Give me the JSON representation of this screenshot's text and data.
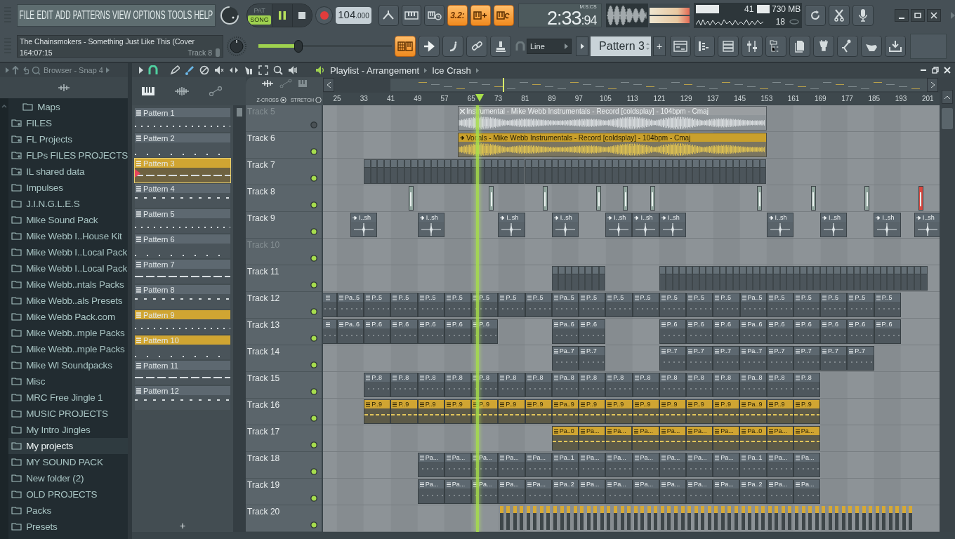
{
  "toolbar": {
    "menu": [
      "FILE",
      "EDIT",
      "ADD",
      "PATTERNS",
      "VIEW",
      "OPTIONS",
      "TOOLS",
      "HELP"
    ],
    "hint": {
      "title": "The Chainsmokers - Something Just Like This (Cover",
      "position": "164:07:15",
      "target": "Track 8"
    },
    "mode": [
      {
        "label": "PAT",
        "selected": false
      },
      {
        "label": "SONG",
        "selected": true
      }
    ],
    "playing": true,
    "tempo": {
      "whole": "104",
      "fraction": ".000"
    },
    "toggles": [
      {
        "kind": "typing",
        "on": false
      },
      {
        "kind": "metronome",
        "on": false
      },
      {
        "kind": "countdown",
        "label": "3.2:",
        "on": true
      },
      {
        "kind": "step",
        "on": true
      },
      {
        "kind": "loop",
        "on": true
      }
    ],
    "time": {
      "main": "2:33",
      "fraction": ":94",
      "unit": "M:S:CS"
    },
    "cpu": {
      "value": "41",
      "level": 0.5
    },
    "memory": "730 MB",
    "polyphony": "18",
    "master_volume": {
      "level": 0.3
    },
    "view_toggles": [
      {
        "kind": "keyboard",
        "on": true
      },
      {
        "kind": "arrow",
        "on": false
      },
      {
        "kind": "foot",
        "on": false
      },
      {
        "kind": "link",
        "on": false
      },
      {
        "kind": "stamp",
        "on": false
      }
    ],
    "snap": "Line",
    "pattern": "Pattern 3",
    "add": "+"
  },
  "browser": {
    "title": "Browser - Snap 4",
    "items": [
      {
        "children": [
          {
            "label": "Maps",
            "kind": "folder",
            "selected": false
          }
        ]
      },
      {
        "label": "FILES",
        "kind": "linked",
        "selected": false
      },
      {
        "label": "FL Projects",
        "kind": "linked",
        "selected": false
      },
      {
        "label": "FLPs FILES PROJECTS",
        "kind": "linked",
        "selected": false
      },
      {
        "label": "IL shared data",
        "kind": "linked",
        "selected": false
      },
      {
        "label": "Impulses",
        "kind": "folder",
        "selected": false
      },
      {
        "label": "J.I.N.G.L.E.S",
        "kind": "folder",
        "selected": false
      },
      {
        "label": "Mike Sound Pack",
        "kind": "folder",
        "selected": false
      },
      {
        "label": "Mike Webb I..House Kit",
        "kind": "folder",
        "selected": false
      },
      {
        "label": "Mike Webb I..Local Pack",
        "kind": "folder",
        "selected": false
      },
      {
        "label": "Mike Webb I..Local Pack",
        "kind": "folder",
        "selected": false
      },
      {
        "label": "Mike Webb..ntals Packs",
        "kind": "folder",
        "selected": false
      },
      {
        "label": "Mike Webb..als Presets",
        "kind": "folder",
        "selected": false
      },
      {
        "label": "Mike Webb Pack.com",
        "kind": "folder",
        "selected": false
      },
      {
        "label": "Mike Webb..mple Packs",
        "kind": "folder",
        "selected": false
      },
      {
        "label": "Mike Webb..mple Packs",
        "kind": "folder",
        "selected": false
      },
      {
        "label": "Mike Wl Soundpacks",
        "kind": "folder",
        "selected": false
      },
      {
        "label": "Misc",
        "kind": "folder",
        "selected": false
      },
      {
        "label": "MRC Free Jingle 1",
        "kind": "folder",
        "selected": false
      },
      {
        "label": "MUSIC PROJECTS",
        "kind": "folder",
        "selected": false
      },
      {
        "label": "My Intro Jingles",
        "kind": "folder",
        "selected": false
      },
      {
        "label": "My projects",
        "kind": "folder",
        "selected": true
      },
      {
        "label": "MY SOUND PACK",
        "kind": "folder",
        "selected": false
      },
      {
        "label": "New folder (2)",
        "kind": "folder",
        "selected": false
      },
      {
        "label": "OLD PROJECTS",
        "kind": "folder",
        "selected": false
      },
      {
        "label": "Packs",
        "kind": "folder",
        "selected": false
      },
      {
        "label": "Presets",
        "kind": "folder",
        "selected": false
      }
    ]
  },
  "playlist": {
    "title": "Playlist - Arrangement",
    "arrangement": "Ice Crash",
    "zcross": {
      "label": "Z-CROSS",
      "on": true
    },
    "stretch": {
      "label": "STRETCH",
      "on": false
    },
    "patterns": [
      {
        "label": "Pattern 1",
        "color": "#5d6870",
        "selected": false
      },
      {
        "label": "Pattern 2",
        "color": "#5d6870",
        "selected": false
      },
      {
        "label": "Pattern 3",
        "color": "#d0a532",
        "selected": true
      },
      {
        "label": "Pattern 4",
        "color": "#5d6870",
        "selected": false
      },
      {
        "label": "Pattern 5",
        "color": "#5d6870",
        "selected": false
      },
      {
        "label": "Pattern 6",
        "color": "#5d6870",
        "selected": false
      },
      {
        "label": "Pattern 7",
        "color": "#5d6870",
        "selected": false
      },
      {
        "label": "Pattern 8",
        "color": "#5d6870",
        "selected": false
      },
      {
        "label": "Pattern 9",
        "color": "#d0a532",
        "selected": false
      },
      {
        "label": "Pattern 10",
        "color": "#d0a532",
        "selected": false
      },
      {
        "label": "Pattern 11",
        "color": "#5d6870",
        "selected": false
      },
      {
        "label": "Pattern 12",
        "color": "#5d6870",
        "selected": false
      }
    ],
    "add_pattern": "+",
    "ruler": [
      "25",
      "33",
      "41",
      "49",
      "57",
      "65",
      "73",
      "81",
      "89",
      "97",
      "105",
      "113",
      "121",
      "129",
      "137",
      "145",
      "153",
      "161",
      "169",
      "177",
      "185",
      "193",
      "201"
    ],
    "position": {
      "level": 0.2506
    },
    "tracks": [
      {
        "name": "Track 5",
        "dimmed": true,
        "muted": true,
        "clips": [
          {
            "kind": "gap"
          },
          {
            "kind": "gap"
          },
          {
            "kind": "gap"
          },
          {
            "kind": "gap"
          },
          {
            "kind": "gap"
          },
          {
            "kind": "gap"
          },
          {
            "kind": "gap"
          },
          {
            "kind": "gap"
          },
          {
            "kind": "gap"
          },
          {
            "kind": "gap"
          },
          {
            "kind": "gap"
          },
          {
            "kind": "audio",
            "label": "Instrumental - Mike Webb Instrumentals - Record [coldsplay] - 104bpm - Cmaj",
            "muted": true,
            "color": "#9a9ea1"
          }
        ]
      },
      {
        "name": "Track 6",
        "dimmed": false,
        "muted": false,
        "clips": [
          {
            "kind": "gap"
          },
          {
            "kind": "gap"
          },
          {
            "kind": "gap"
          },
          {
            "kind": "gap"
          },
          {
            "kind": "gap"
          },
          {
            "kind": "gap"
          },
          {
            "kind": "gap"
          },
          {
            "kind": "gap"
          },
          {
            "kind": "gap"
          },
          {
            "kind": "gap"
          },
          {
            "kind": "gap"
          },
          {
            "kind": "audio",
            "label": "Vocals - Mike Webb Instrumentals - Record [coldsplay] - 104bpm - Cmaj",
            "muted": false,
            "color": "#c9a02c"
          }
        ]
      },
      {
        "name": "Track 7",
        "dimmed": false,
        "muted": false,
        "clips": [
          {
            "kind": "gap"
          },
          {
            "kind": "gap"
          },
          {
            "kind": "gap"
          },
          {
            "kind": "gap"
          },
          {
            "kind": "mini"
          },
          {
            "kind": "mini"
          },
          {
            "kind": "mini"
          },
          {
            "kind": "mini"
          },
          {
            "kind": "mini"
          },
          {
            "kind": "mini"
          },
          {
            "kind": "mini"
          },
          {
            "kind": "mini"
          },
          {
            "kind": "mini"
          },
          {
            "kind": "mini"
          },
          {
            "kind": "mini"
          },
          {
            "kind": "mini"
          },
          {
            "kind": "mini"
          },
          {
            "kind": "mini"
          },
          {
            "kind": "mini"
          },
          {
            "kind": "mini"
          },
          {
            "kind": "mini"
          },
          {
            "kind": "mini"
          },
          {
            "kind": "mini"
          },
          {
            "kind": "mini"
          },
          {
            "kind": "mini"
          },
          {
            "kind": "mini"
          },
          {
            "kind": "mini"
          },
          {
            "kind": "mini"
          },
          {
            "kind": "mini"
          },
          {
            "kind": "mini"
          },
          {
            "kind": "mini"
          },
          {
            "kind": "mini"
          },
          {
            "kind": "mini"
          },
          {
            "kind": "mini"
          }
        ]
      },
      {
        "name": "Track 8",
        "dimmed": false,
        "muted": false,
        "clips": [
          {
            "kind": "gap"
          },
          {
            "kind": "gap"
          },
          {
            "kind": "gap"
          },
          {
            "kind": "gap"
          },
          {
            "kind": "gap"
          },
          {
            "kind": "gap"
          },
          {
            "kind": "gap"
          },
          {
            "kind": "automation",
            "color": "#8fa39c"
          },
          {
            "kind": "gap"
          },
          {
            "kind": "gap"
          },
          {
            "kind": "gap"
          },
          {
            "kind": "gap"
          },
          {
            "kind": "gap"
          },
          {
            "kind": "automation",
            "color": "#8fa39c"
          },
          {
            "kind": "gap"
          },
          {
            "kind": "gap"
          },
          {
            "kind": "gap"
          },
          {
            "kind": "automation",
            "color": "#8fa39c"
          },
          {
            "kind": "gap"
          },
          {
            "kind": "gap"
          },
          {
            "kind": "gap"
          },
          {
            "kind": "automation",
            "color": "#8fa39c"
          },
          {
            "kind": "gap"
          },
          {
            "kind": "automation",
            "color": "#8fa39c"
          },
          {
            "kind": "gap"
          },
          {
            "kind": "automation",
            "color": "#8fa39c"
          },
          {
            "kind": "gap"
          },
          {
            "kind": "gap"
          },
          {
            "kind": "gap"
          },
          {
            "kind": "gap"
          },
          {
            "kind": "gap"
          },
          {
            "kind": "gap"
          },
          {
            "kind": "gap"
          },
          {
            "kind": "automation",
            "color": "#8fa39c"
          },
          {
            "kind": "gap"
          },
          {
            "kind": "gap"
          },
          {
            "kind": "gap"
          },
          {
            "kind": "automation",
            "color": "#8fa39c"
          },
          {
            "kind": "gap"
          },
          {
            "kind": "gap"
          },
          {
            "kind": "gap"
          },
          {
            "kind": "automation",
            "color": "#8fa39c"
          },
          {
            "kind": "gap"
          },
          {
            "kind": "gap"
          },
          {
            "kind": "gap"
          },
          {
            "kind": "automation",
            "color": "#d8473f"
          }
        ]
      },
      {
        "name": "Track 9",
        "dimmed": false,
        "muted": false,
        "clips": [
          {
            "kind": "gap"
          },
          {
            "kind": "gap"
          },
          {
            "kind": "gap"
          },
          {
            "kind": "one_shot",
            "label": "I..sh"
          },
          {
            "kind": "gap"
          },
          {
            "kind": "gap"
          },
          {
            "kind": "gap"
          },
          {
            "kind": "one_shot",
            "label": "I..sh"
          },
          {
            "kind": "gap"
          },
          {
            "kind": "gap"
          },
          {
            "kind": "gap"
          },
          {
            "kind": "gap"
          },
          {
            "kind": "one_shot",
            "label": "I..sh"
          },
          {
            "kind": "gap"
          },
          {
            "kind": "gap"
          },
          {
            "kind": "one_shot",
            "label": "I..sh"
          },
          {
            "kind": "gap"
          },
          {
            "kind": "gap"
          },
          {
            "kind": "one_shot",
            "label": "I..sh"
          },
          {
            "kind": "one_shot",
            "label": "I..sh"
          },
          {
            "kind": "one_shot",
            "label": "I..sh"
          },
          {
            "kind": "gap"
          },
          {
            "kind": "gap"
          },
          {
            "kind": "gap"
          },
          {
            "kind": "gap"
          },
          {
            "kind": "gap"
          },
          {
            "kind": "gap"
          },
          {
            "kind": "one_shot",
            "label": "I..sh"
          },
          {
            "kind": "gap"
          },
          {
            "kind": "gap"
          },
          {
            "kind": "one_shot",
            "label": "I..sh"
          },
          {
            "kind": "gap"
          },
          {
            "kind": "gap"
          },
          {
            "kind": "one_shot",
            "label": "I..sh"
          },
          {
            "kind": "gap"
          },
          {
            "kind": "one_shot",
            "label": "I..sh"
          }
        ]
      },
      {
        "name": "Track 10",
        "dimmed": true,
        "muted": false
      },
      {
        "name": "Track 11",
        "dimmed": false,
        "muted": false,
        "clips": [
          {
            "kind": "gap"
          },
          {
            "kind": "gap"
          },
          {
            "kind": "gap"
          },
          {
            "kind": "gap"
          },
          {
            "kind": "gap"
          },
          {
            "kind": "gap"
          },
          {
            "kind": "gap"
          },
          {
            "kind": "gap"
          },
          {
            "kind": "gap"
          },
          {
            "kind": "gap"
          },
          {
            "kind": "gap"
          },
          {
            "kind": "gap"
          },
          {
            "kind": "gap"
          },
          {
            "kind": "gap"
          },
          {
            "kind": "gap"
          },
          {
            "kind": "gap"
          },
          {
            "kind": "gap"
          },
          {
            "kind": "gap"
          },
          {
            "kind": "mini"
          },
          {
            "kind": "mini"
          },
          {
            "kind": "mini"
          },
          {
            "kind": "mini"
          },
          {
            "kind": "gap"
          },
          {
            "kind": "gap"
          },
          {
            "kind": "gap"
          },
          {
            "kind": "gap"
          },
          {
            "kind": "mini"
          },
          {
            "kind": "mini"
          },
          {
            "kind": "mini"
          },
          {
            "kind": "mini"
          },
          {
            "kind": "mini"
          },
          {
            "kind": "mini"
          },
          {
            "kind": "mini"
          },
          {
            "kind": "mini"
          },
          {
            "kind": "mini"
          },
          {
            "kind": "mini"
          },
          {
            "kind": "mini"
          },
          {
            "kind": "mini"
          },
          {
            "kind": "mini"
          },
          {
            "kind": "mini"
          },
          {
            "kind": "mini"
          },
          {
            "kind": "mini"
          },
          {
            "kind": "mini"
          },
          {
            "kind": "mini"
          },
          {
            "kind": "mini"
          },
          {
            "kind": "mini"
          }
        ]
      },
      {
        "name": "Track 12",
        "dimmed": false,
        "muted": false,
        "clips": [
          {
            "kind": "pattern",
            "color": "#5d6870"
          },
          {
            "kind": "pattern",
            "label": "Pa..5",
            "color": "#5d6870"
          },
          {
            "kind": "pattern",
            "label": "P..5",
            "color": "#5d6870"
          },
          {
            "kind": "pattern",
            "label": "P..5",
            "color": "#5d6870"
          },
          {
            "kind": "pattern",
            "label": "P..5",
            "color": "#5d6870"
          },
          {
            "kind": "pattern",
            "label": "P..5",
            "color": "#5d6870"
          },
          {
            "kind": "pattern",
            "label": "P..5",
            "color": "#5d6870"
          },
          {
            "kind": "pattern",
            "label": "P..5",
            "color": "#5d6870"
          },
          {
            "kind": "pattern",
            "label": "P..5",
            "color": "#5d6870"
          },
          {
            "kind": "pattern",
            "label": "Pa..5",
            "color": "#5d6870"
          },
          {
            "kind": "pattern",
            "label": "P..5",
            "color": "#5d6870"
          },
          {
            "kind": "pattern",
            "label": "P..5",
            "color": "#5d6870"
          },
          {
            "kind": "pattern",
            "label": "P..5",
            "color": "#5d6870"
          },
          {
            "kind": "pattern",
            "label": "P..5",
            "color": "#5d6870"
          },
          {
            "kind": "pattern",
            "label": "P..5",
            "color": "#5d6870"
          },
          {
            "kind": "pattern",
            "label": "P..5",
            "color": "#5d6870"
          },
          {
            "kind": "pattern",
            "label": "Pa..5",
            "color": "#5d6870"
          },
          {
            "kind": "pattern",
            "label": "P..5",
            "color": "#5d6870"
          },
          {
            "kind": "pattern",
            "label": "P..5",
            "color": "#5d6870"
          },
          {
            "kind": "pattern",
            "label": "P..5",
            "color": "#5d6870"
          },
          {
            "kind": "pattern",
            "label": "P..5",
            "color": "#5d6870"
          },
          {
            "kind": "pattern",
            "label": "P..5",
            "color": "#5d6870"
          }
        ]
      },
      {
        "name": "Track 13",
        "dimmed": false,
        "muted": false,
        "clips": [
          {
            "kind": "pattern",
            "color": "#5d6870"
          },
          {
            "kind": "pattern",
            "label": "Pa..6",
            "color": "#5d6870"
          },
          {
            "kind": "pattern",
            "label": "P..6",
            "color": "#5d6870"
          },
          {
            "kind": "pattern",
            "label": "P..6",
            "color": "#5d6870"
          },
          {
            "kind": "pattern",
            "label": "P..6",
            "color": "#5d6870"
          },
          {
            "kind": "pattern",
            "label": "P..6",
            "color": "#5d6870"
          },
          {
            "kind": "pattern",
            "label": "P..6",
            "color": "#5d6870"
          },
          {
            "kind": "gap"
          },
          {
            "kind": "gap"
          },
          {
            "kind": "gap"
          },
          {
            "kind": "gap"
          },
          {
            "kind": "pattern",
            "label": "Pa..6",
            "color": "#5d6870"
          },
          {
            "kind": "pattern",
            "label": "P..6",
            "color": "#5d6870"
          },
          {
            "kind": "gap"
          },
          {
            "kind": "gap"
          },
          {
            "kind": "gap"
          },
          {
            "kind": "gap"
          },
          {
            "kind": "pattern",
            "label": "P..6",
            "color": "#5d6870"
          },
          {
            "kind": "pattern",
            "label": "P..6",
            "color": "#5d6870"
          },
          {
            "kind": "pattern",
            "label": "P..6",
            "color": "#5d6870"
          },
          {
            "kind": "pattern",
            "label": "Pa..6",
            "color": "#5d6870"
          },
          {
            "kind": "pattern",
            "label": "P..6",
            "color": "#5d6870"
          },
          {
            "kind": "pattern",
            "label": "P..6",
            "color": "#5d6870"
          },
          {
            "kind": "pattern",
            "label": "P..6",
            "color": "#5d6870"
          },
          {
            "kind": "pattern",
            "label": "P..6",
            "color": "#5d6870"
          },
          {
            "kind": "pattern",
            "label": "P..6",
            "color": "#5d6870"
          }
        ]
      },
      {
        "name": "Track 14",
        "dimmed": false,
        "muted": false,
        "clips": [
          {
            "kind": "gap"
          },
          {
            "kind": "gap"
          },
          {
            "kind": "gap"
          },
          {
            "kind": "gap"
          },
          {
            "kind": "gap"
          },
          {
            "kind": "gap"
          },
          {
            "kind": "gap"
          },
          {
            "kind": "gap"
          },
          {
            "kind": "gap"
          },
          {
            "kind": "gap"
          },
          {
            "kind": "gap"
          },
          {
            "kind": "gap"
          },
          {
            "kind": "gap"
          },
          {
            "kind": "gap"
          },
          {
            "kind": "gap"
          },
          {
            "kind": "gap"
          },
          {
            "kind": "gap"
          },
          {
            "kind": "gap"
          },
          {
            "kind": "pattern",
            "label": "Pa..7",
            "color": "#5d6870"
          },
          {
            "kind": "pattern",
            "label": "P..7",
            "color": "#5d6870"
          },
          {
            "kind": "gap"
          },
          {
            "kind": "gap"
          },
          {
            "kind": "gap"
          },
          {
            "kind": "gap"
          },
          {
            "kind": "pattern",
            "label": "P..7",
            "color": "#5d6870"
          },
          {
            "kind": "pattern",
            "label": "P..7",
            "color": "#5d6870"
          },
          {
            "kind": "pattern",
            "label": "P..7",
            "color": "#5d6870"
          },
          {
            "kind": "pattern",
            "label": "Pa..7",
            "color": "#5d6870"
          },
          {
            "kind": "pattern",
            "label": "P..7",
            "color": "#5d6870"
          },
          {
            "kind": "pattern",
            "label": "P..7",
            "color": "#5d6870"
          },
          {
            "kind": "pattern",
            "label": "P..7",
            "color": "#5d6870"
          },
          {
            "kind": "pattern",
            "label": "P..7",
            "color": "#5d6870"
          }
        ]
      },
      {
        "name": "Track 15",
        "dimmed": false,
        "muted": false,
        "clips": [
          {
            "kind": "gap"
          },
          {
            "kind": "gap"
          },
          {
            "kind": "gap"
          },
          {
            "kind": "gap"
          },
          {
            "kind": "pattern",
            "label": "P..8",
            "color": "#5d6870"
          },
          {
            "kind": "pattern",
            "label": "P..8",
            "color": "#5d6870"
          },
          {
            "kind": "pattern",
            "label": "P..8",
            "color": "#5d6870"
          },
          {
            "kind": "pattern",
            "label": "P..8",
            "color": "#5d6870"
          },
          {
            "kind": "pattern",
            "label": "P..8",
            "color": "#5d6870"
          },
          {
            "kind": "pattern",
            "label": "P..8",
            "color": "#5d6870"
          },
          {
            "kind": "pattern",
            "label": "P..8",
            "color": "#5d6870"
          },
          {
            "kind": "pattern",
            "label": "Pa..8",
            "color": "#5d6870"
          },
          {
            "kind": "pattern",
            "label": "P..8",
            "color": "#5d6870"
          },
          {
            "kind": "pattern",
            "label": "P..8",
            "color": "#5d6870"
          },
          {
            "kind": "pattern",
            "label": "P..8",
            "color": "#5d6870"
          },
          {
            "kind": "pattern",
            "label": "P..8",
            "color": "#5d6870"
          },
          {
            "kind": "pattern",
            "label": "P..8",
            "color": "#5d6870"
          },
          {
            "kind": "pattern",
            "label": "P..8",
            "color": "#5d6870"
          },
          {
            "kind": "pattern",
            "label": "Pa..8",
            "color": "#5d6870"
          },
          {
            "kind": "pattern",
            "label": "P..8",
            "color": "#5d6870"
          },
          {
            "kind": "pattern",
            "label": "P..8",
            "color": "#5d6870"
          }
        ]
      },
      {
        "name": "Track 16",
        "dimmed": false,
        "muted": false,
        "clips": [
          {
            "kind": "gap"
          },
          {
            "kind": "gap"
          },
          {
            "kind": "gap"
          },
          {
            "kind": "gap"
          },
          {
            "kind": "pattern",
            "label": "P..9",
            "color": "#d0a532"
          },
          {
            "kind": "pattern",
            "label": "P..9",
            "color": "#d0a532"
          },
          {
            "kind": "pattern",
            "label": "P..9",
            "color": "#d0a532"
          },
          {
            "kind": "pattern",
            "label": "P..9",
            "color": "#d0a532"
          },
          {
            "kind": "pattern",
            "label": "P..9",
            "color": "#d0a532"
          },
          {
            "kind": "pattern",
            "label": "P..9",
            "color": "#d0a532"
          },
          {
            "kind": "pattern",
            "label": "P..9",
            "color": "#d0a532"
          },
          {
            "kind": "pattern",
            "label": "Pa..9",
            "color": "#d0a532"
          },
          {
            "kind": "pattern",
            "label": "P..9",
            "color": "#d0a532"
          },
          {
            "kind": "pattern",
            "label": "P..9",
            "color": "#d0a532"
          },
          {
            "kind": "pattern",
            "label": "P..9",
            "color": "#d0a532"
          },
          {
            "kind": "pattern",
            "label": "P..9",
            "color": "#d0a532"
          },
          {
            "kind": "pattern",
            "label": "P..9",
            "color": "#d0a532"
          },
          {
            "kind": "pattern",
            "label": "P..9",
            "color": "#d0a532"
          },
          {
            "kind": "pattern",
            "label": "Pa..9",
            "color": "#d0a532"
          },
          {
            "kind": "pattern",
            "label": "P..9",
            "color": "#d0a532"
          },
          {
            "kind": "pattern",
            "label": "P..9",
            "color": "#d0a532"
          }
        ]
      },
      {
        "name": "Track 17",
        "dimmed": false,
        "muted": false,
        "clips": [
          {
            "kind": "gap"
          },
          {
            "kind": "gap"
          },
          {
            "kind": "gap"
          },
          {
            "kind": "gap"
          },
          {
            "kind": "gap"
          },
          {
            "kind": "gap"
          },
          {
            "kind": "gap"
          },
          {
            "kind": "gap"
          },
          {
            "kind": "gap"
          },
          {
            "kind": "gap"
          },
          {
            "kind": "gap"
          },
          {
            "kind": "gap"
          },
          {
            "kind": "gap"
          },
          {
            "kind": "gap"
          },
          {
            "kind": "gap"
          },
          {
            "kind": "gap"
          },
          {
            "kind": "gap"
          },
          {
            "kind": "gap"
          },
          {
            "kind": "pattern",
            "label": "Pa..0",
            "color": "#d0a532"
          },
          {
            "kind": "pattern",
            "label": "Pa...",
            "color": "#d0a532"
          },
          {
            "kind": "pattern",
            "label": "Pa...",
            "color": "#d0a532"
          },
          {
            "kind": "pattern",
            "label": "Pa...",
            "color": "#d0a532"
          },
          {
            "kind": "pattern",
            "label": "Pa...",
            "color": "#d0a532"
          },
          {
            "kind": "pattern",
            "label": "Pa...",
            "color": "#d0a532"
          },
          {
            "kind": "pattern",
            "label": "Pa...",
            "color": "#d0a532"
          },
          {
            "kind": "pattern",
            "label": "Pa..0",
            "color": "#d0a532"
          },
          {
            "kind": "pattern",
            "label": "Pa...",
            "color": "#d0a532"
          },
          {
            "kind": "pattern",
            "label": "Pa...",
            "color": "#d0a532"
          }
        ]
      },
      {
        "name": "Track 18",
        "dimmed": false,
        "muted": false,
        "clips": [
          {
            "kind": "gap"
          },
          {
            "kind": "gap"
          },
          {
            "kind": "gap"
          },
          {
            "kind": "gap"
          },
          {
            "kind": "gap"
          },
          {
            "kind": "gap"
          },
          {
            "kind": "gap"
          },
          {
            "kind": "gap"
          },
          {
            "kind": "pattern",
            "label": "Pa...",
            "color": "#5d6870"
          },
          {
            "kind": "pattern",
            "label": "Pa...",
            "color": "#5d6870"
          },
          {
            "kind": "pattern",
            "label": "Pa...",
            "color": "#5d6870"
          },
          {
            "kind": "pattern",
            "label": "Pa...",
            "color": "#5d6870"
          },
          {
            "kind": "pattern",
            "label": "Pa...",
            "color": "#5d6870"
          },
          {
            "kind": "pattern",
            "label": "Pa..1",
            "color": "#5d6870"
          },
          {
            "kind": "pattern",
            "label": "Pa...",
            "color": "#5d6870"
          },
          {
            "kind": "pattern",
            "label": "Pa...",
            "color": "#5d6870"
          },
          {
            "kind": "pattern",
            "label": "Pa...",
            "color": "#5d6870"
          },
          {
            "kind": "pattern",
            "label": "Pa...",
            "color": "#5d6870"
          },
          {
            "kind": "pattern",
            "label": "Pa...",
            "color": "#5d6870"
          },
          {
            "kind": "pattern",
            "label": "Pa...",
            "color": "#5d6870"
          },
          {
            "kind": "pattern",
            "label": "Pa..1",
            "color": "#5d6870"
          },
          {
            "kind": "pattern",
            "label": "Pa...",
            "color": "#5d6870"
          },
          {
            "kind": "pattern",
            "label": "Pa...",
            "color": "#5d6870"
          }
        ]
      },
      {
        "name": "Track 19",
        "dimmed": false,
        "muted": false,
        "clips": [
          {
            "kind": "gap"
          },
          {
            "kind": "gap"
          },
          {
            "kind": "gap"
          },
          {
            "kind": "gap"
          },
          {
            "kind": "gap"
          },
          {
            "kind": "gap"
          },
          {
            "kind": "gap"
          },
          {
            "kind": "gap"
          },
          {
            "kind": "pattern",
            "label": "Pa...",
            "color": "#5d6870"
          },
          {
            "kind": "pattern",
            "label": "Pa...",
            "color": "#5d6870"
          },
          {
            "kind": "pattern",
            "label": "Pa...",
            "color": "#5d6870"
          },
          {
            "kind": "pattern",
            "label": "Pa...",
            "color": "#5d6870"
          },
          {
            "kind": "pattern",
            "label": "Pa...",
            "color": "#5d6870"
          },
          {
            "kind": "pattern",
            "label": "Pa..2",
            "color": "#5d6870"
          },
          {
            "kind": "pattern",
            "label": "Pa...",
            "color": "#5d6870"
          },
          {
            "kind": "pattern",
            "label": "Pa...",
            "color": "#5d6870"
          },
          {
            "kind": "pattern",
            "label": "Pa...",
            "color": "#5d6870"
          },
          {
            "kind": "pattern",
            "label": "Pa...",
            "color": "#5d6870"
          },
          {
            "kind": "pattern",
            "label": "Pa...",
            "color": "#5d6870"
          },
          {
            "kind": "pattern",
            "label": "Pa...",
            "color": "#5d6870"
          },
          {
            "kind": "pattern",
            "label": "Pa..2",
            "color": "#5d6870"
          },
          {
            "kind": "pattern",
            "label": "Pa...",
            "color": "#5d6870"
          },
          {
            "kind": "pattern",
            "label": "Pa...",
            "color": "#5d6870"
          }
        ]
      },
      {
        "name": "Track 20",
        "dimmed": false,
        "muted": false,
        "clips": [
          {
            "kind": "gap"
          },
          {
            "kind": "gap"
          },
          {
            "kind": "gap"
          },
          {
            "kind": "gap"
          },
          {
            "kind": "gap"
          },
          {
            "kind": "gap"
          },
          {
            "kind": "gap"
          },
          {
            "kind": "gap"
          },
          {
            "kind": "gap"
          },
          {
            "kind": "gap"
          },
          {
            "kind": "gap"
          },
          {
            "kind": "gap"
          },
          {
            "kind": "gap"
          },
          {
            "kind": "gap"
          },
          {
            "kind": "slices"
          },
          {
            "kind": "slices"
          },
          {
            "kind": "slices"
          },
          {
            "kind": "slices"
          },
          {
            "kind": "slices"
          },
          {
            "kind": "slices"
          },
          {
            "kind": "slices"
          },
          {
            "kind": "slices"
          },
          {
            "kind": "slices"
          },
          {
            "kind": "slices"
          },
          {
            "kind": "slices"
          },
          {
            "kind": "slices"
          },
          {
            "kind": "slices"
          },
          {
            "kind": "slices"
          },
          {
            "kind": "slices"
          },
          {
            "kind": "slices"
          },
          {
            "kind": "slices"
          },
          {
            "kind": "slices"
          },
          {
            "kind": "slices"
          },
          {
            "kind": "slices"
          },
          {
            "kind": "slices"
          },
          {
            "kind": "slices"
          },
          {
            "kind": "slices"
          },
          {
            "kind": "slices"
          },
          {
            "kind": "slices"
          },
          {
            "kind": "slices"
          },
          {
            "kind": "slices"
          },
          {
            "kind": "slices"
          },
          {
            "kind": "slices"
          },
          {
            "kind": "slices"
          },
          {
            "kind": "slices"
          }
        ]
      }
    ]
  }
}
